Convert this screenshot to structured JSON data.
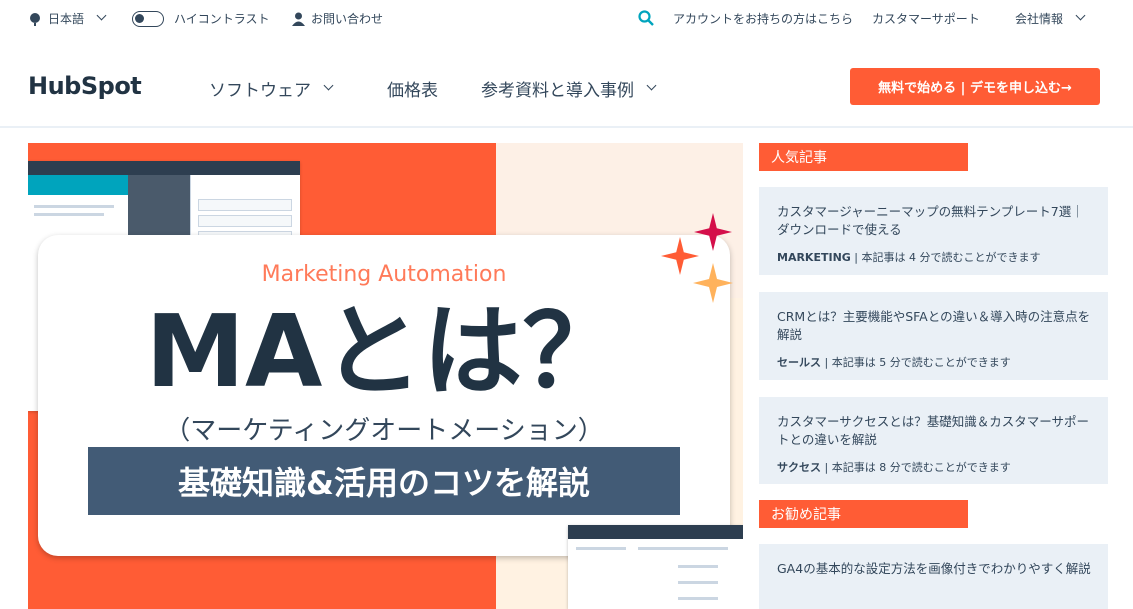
{
  "utility_bar": {
    "language": "日本語",
    "high_contrast": "ハイコントラスト",
    "contact": "お問い合わせ",
    "login": "アカウントをお持ちの方はこちら",
    "support": "カスタマーサポート",
    "company": "会社情報"
  },
  "nav": {
    "logo": "HubSpot",
    "items": [
      {
        "label": "ソフトウェア"
      },
      {
        "label": "価格表"
      },
      {
        "label": "参考資料と導入事例"
      }
    ],
    "cta": "無料で始める | デモを申し込む→"
  },
  "hero": {
    "subtitle": "Marketing Automation",
    "title": "MAとは？",
    "parenthetical": "（マーケティングオートメーション）",
    "band": "基礎知識&活用のコツを解説",
    "colors": {
      "accent": "#ff5c35",
      "navy": "#213343",
      "band": "#425b76",
      "peach": "#fdf0e6"
    }
  },
  "sidebar": {
    "popular_heading": "人気記事",
    "popular": [
      {
        "title": "カスタマージャーニーマップの無料テンプレート7選｜ダウンロードで使える",
        "category": "MARKETING",
        "read_time": " | 本記事は 4 分で読むことができます"
      },
      {
        "title": "CRMとは？主要機能やSFAとの違い＆導入時の注意点を解説",
        "category": "セールス",
        "read_time": " | 本記事は 5 分で読むことができます"
      },
      {
        "title": "カスタマーサクセスとは？基礎知識＆カスタマーサポートとの違いを解説",
        "category": "サクセス",
        "read_time": " | 本記事は 8 分で読むことができます"
      }
    ],
    "recommended_heading": "お勧め記事",
    "recommended": [
      {
        "title": "GA4の基本的な設定方法を画像付きでわかりやすく解説"
      }
    ]
  }
}
